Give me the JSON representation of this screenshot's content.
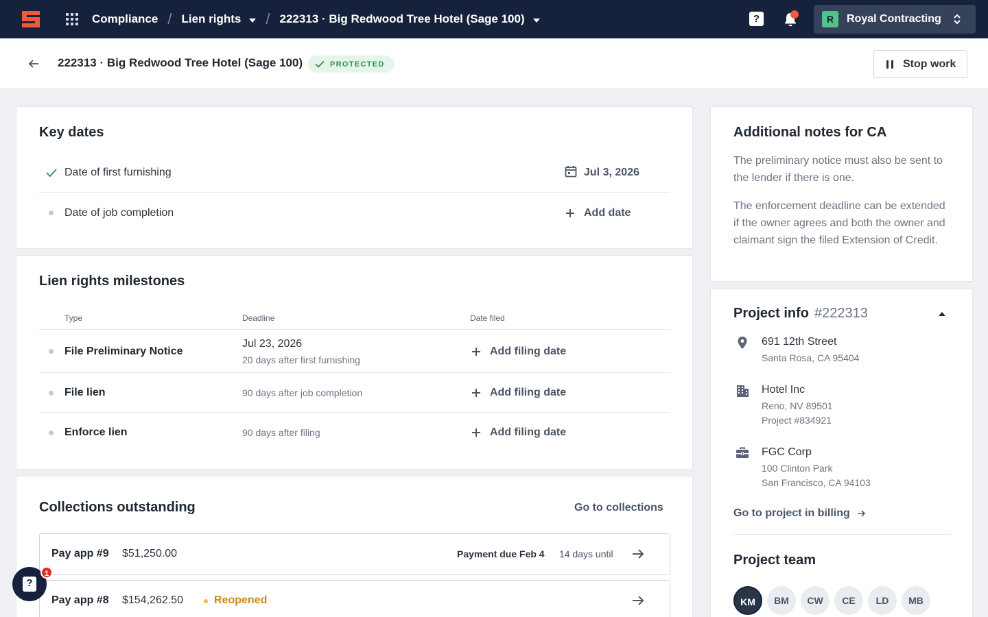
{
  "nav": {
    "breadcrumbs": [
      "Compliance",
      "Lien rights",
      "222313 · Big Redwood Tree Hotel (Sage 100)"
    ],
    "help_glyph": "?",
    "org": {
      "initial": "R",
      "name": "Royal Contracting"
    },
    "icons": [
      "logo-icon",
      "apps-grid-icon",
      "help-icon",
      "bell-icon",
      "switch-org-icon"
    ]
  },
  "header": {
    "title": "222313 · Big Redwood Tree Hotel (Sage 100)",
    "status": "PROTECTED",
    "stop_work_label": "Stop work"
  },
  "key_dates": {
    "title": "Key dates",
    "rows": [
      {
        "label": "Date of first furnishing",
        "value": "Jul 3, 2026",
        "done": true
      },
      {
        "label": "Date of job completion",
        "action": "Add date",
        "done": false
      }
    ]
  },
  "milestones": {
    "title": "Lien rights milestones",
    "columns": [
      "Type",
      "Deadline",
      "Date filed"
    ],
    "rows": [
      {
        "type": "File Preliminary Notice",
        "deadline": "Jul 23, 2026",
        "deadline_note": "20 days after first furnishing",
        "filed_action": "Add filing date"
      },
      {
        "type": "File lien",
        "deadline": "",
        "deadline_note": "90 days after job completion",
        "filed_action": "Add filing date"
      },
      {
        "type": "Enforce lien",
        "deadline": "",
        "deadline_note": "90 days after filing",
        "filed_action": "Add filing date"
      }
    ]
  },
  "collections": {
    "title": "Collections outstanding",
    "link": "Go to collections",
    "items": [
      {
        "pay_app": "Pay app #9",
        "amount": "$51,250.00",
        "due": "Payment due Feb 4",
        "until": "14 days until"
      },
      {
        "pay_app": "Pay app #8",
        "amount": "$154,262.50",
        "status": "Reopened"
      }
    ]
  },
  "notes": {
    "title": "Additional notes for CA",
    "paragraphs": [
      "The preliminary notice must also be sent to the lender if there is one.",
      "The enforcement deadline can be extended if the owner agrees and both the owner and claimant sign the filed Extension of Credit."
    ]
  },
  "project_info": {
    "title": "Project info",
    "number": "#222313",
    "address": {
      "line1": "691 12th Street",
      "line2": "Santa Rosa, CA 95404"
    },
    "owner": {
      "name": "Hotel Inc",
      "line1": "Reno, NV 89501",
      "line2": "Project #834921"
    },
    "gc": {
      "name": "FGC Corp",
      "line1": "100 Clinton Park",
      "line2": "San Francisco, CA 94103"
    },
    "link": "Go to project in billing"
  },
  "team": {
    "title": "Project team",
    "members": [
      "KM",
      "BM",
      "CW",
      "CE",
      "LD",
      "MB"
    ]
  },
  "support": {
    "glyph": "?",
    "badge": "1"
  },
  "colors": {
    "nav_bg": "#16223b",
    "accent_green": "#2f8a52",
    "warning": "#c98a16",
    "notification": "#ef5a3b"
  }
}
